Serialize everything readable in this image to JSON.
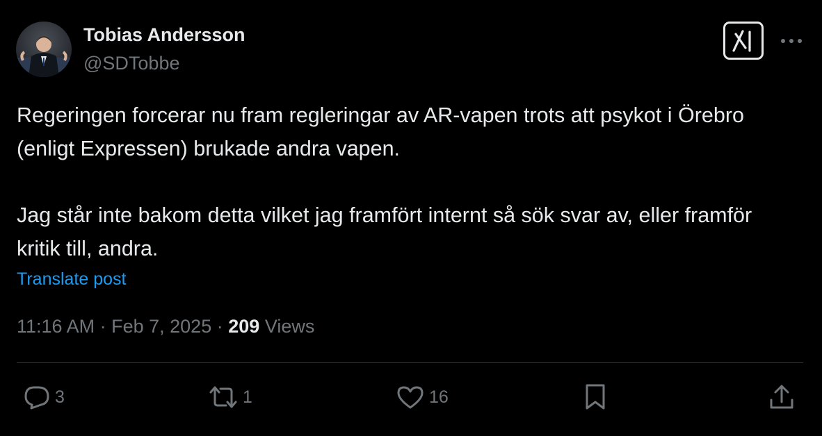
{
  "author": {
    "name": "Tobias Andersson",
    "handle": "@SDTobbe"
  },
  "post": {
    "paragraphs": [
      "Regeringen forcerar nu fram regleringar av AR-vapen trots att psykot i Örebro (enligt Expressen) brukade andra vapen.",
      "Jag står inte bakom detta vilket jag framfört internt så sök svar av, eller framför kritik till, andra."
    ],
    "translate_label": "Translate post"
  },
  "meta": {
    "time": "11:16 AM",
    "separator": "·",
    "date": "Feb 7, 2025",
    "views_count": "209",
    "views_label": "Views"
  },
  "actions": {
    "replies": "3",
    "reposts": "1",
    "likes": "16"
  },
  "colors": {
    "background": "#000000",
    "text": "#e7e9ea",
    "muted": "#71767b",
    "link": "#1d9bf0",
    "divider": "#2f3336"
  },
  "icons": {
    "grok": "grok-icon",
    "more": "more-icon",
    "reply": "reply-icon",
    "repost": "repost-icon",
    "like": "heart-icon",
    "bookmark": "bookmark-icon",
    "share": "share-icon"
  }
}
